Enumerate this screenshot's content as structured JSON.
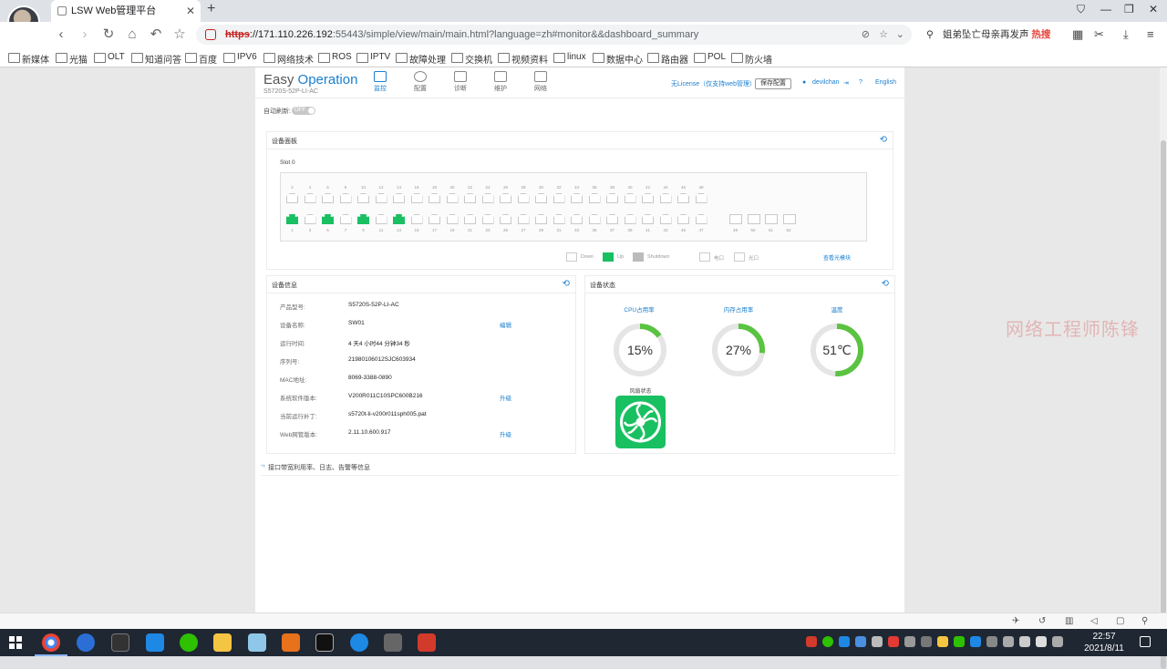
{
  "browser": {
    "tab_title": "LSW Web管理平台",
    "url_scheme": "https",
    "url_host": "://171.110.226.192",
    "url_rest": ":55443/simple/view/main/main.html?language=zh#monitor&&dashboard_summary",
    "search_text": "姐弟坠亡母亲再发声",
    "search_badge": "热搜",
    "bookmarks": [
      "新媒体",
      "光猫",
      "OLT",
      "知道问答",
      "百度",
      "IPV6",
      "网络技术",
      "ROS",
      "IPTV",
      "故障处理",
      "交换机",
      "视频资料",
      "linux",
      "数据中心",
      "路由器",
      "POL",
      "防火墙"
    ]
  },
  "app": {
    "logo_easy": "Easy",
    "logo_operation": "Operation",
    "model": "S5720S-52P-LI-AC",
    "nav": [
      "监控",
      "配置",
      "诊断",
      "维护",
      "网络"
    ],
    "license": "无License（仅支持web管理）",
    "save_config": "保存配置",
    "user": "devilchan",
    "help": "?",
    "language": "English",
    "auto_refresh": "自动刷新:",
    "toggle": "OFF"
  },
  "device_panel": {
    "title": "设备面板",
    "slot": "Slot 0",
    "top_numbers": [
      "2",
      "4",
      "6",
      "8",
      "10",
      "12",
      "14",
      "16",
      "18",
      "20",
      "22",
      "24",
      "26",
      "28",
      "30",
      "32",
      "34",
      "36",
      "38",
      "40",
      "42",
      "44",
      "46",
      "48"
    ],
    "bottom_numbers": [
      "1",
      "3",
      "5",
      "7",
      "9",
      "11",
      "13",
      "15",
      "17",
      "19",
      "21",
      "23",
      "25",
      "27",
      "29",
      "31",
      "33",
      "35",
      "37",
      "39",
      "41",
      "43",
      "45",
      "47"
    ],
    "sfp_numbers": [
      "49",
      "50",
      "51",
      "52"
    ],
    "up_ports_bottom": [
      1,
      5,
      9,
      13
    ],
    "legend": [
      "Down",
      "Up",
      "Shutdown",
      "电口",
      "光口"
    ],
    "optical_link": "查看光模块"
  },
  "device_info": {
    "title": "设备信息",
    "rows": [
      {
        "label": "产品型号:",
        "value": "S5720S-52P-LI-AC",
        "link": ""
      },
      {
        "label": "设备名称:",
        "value": "SW01",
        "link": "编辑"
      },
      {
        "label": "运行时间:",
        "value": "4 天4 小时44 分钟34 秒",
        "link": ""
      },
      {
        "label": "序列号:",
        "value": "21980106012SJC603934",
        "link": ""
      },
      {
        "label": "MAC地址:",
        "value": "8069-3388-0890",
        "link": ""
      },
      {
        "label": "系统软件版本:",
        "value": "V200R011C10SPC600B216",
        "link": "升级"
      },
      {
        "label": "当前运行补丁:",
        "value": "s5720t-li-v200r011sph005.pat",
        "link": ""
      },
      {
        "label": "Web网管版本:",
        "value": "2.11.10.600.917",
        "link": "升级"
      }
    ]
  },
  "device_status": {
    "title": "设备状态",
    "cpu_label": "CPU占用率",
    "cpu_value": "15%",
    "cpu_pct": 15,
    "mem_label": "内存占用率",
    "mem_value": "27%",
    "mem_pct": 27,
    "temp_label": "温度",
    "temp_value": "51℃",
    "temp_pct": 51,
    "fan_label": "风扇状态"
  },
  "more": "接口带宽利用率、日志、告警等信息",
  "watermark": "网络工程师陈锋",
  "clock": {
    "time": "22:57",
    "date": "2021/8/11"
  },
  "colors": {
    "accent": "#1a7fd0",
    "port_up": "#19c061",
    "gauge": "#5ac341"
  }
}
